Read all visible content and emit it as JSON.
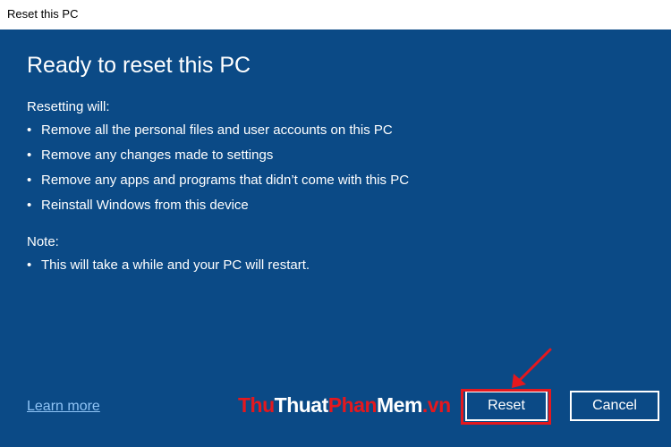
{
  "window": {
    "title": "Reset this PC"
  },
  "dialog": {
    "heading": "Ready to reset this PC",
    "resetting_label": "Resetting will:",
    "resetting_items": [
      "Remove all the personal files and user accounts on this PC",
      "Remove any changes made to settings",
      "Remove any apps and programs that didn’t come with this PC",
      "Reinstall Windows from this device"
    ],
    "note_label": "Note:",
    "note_items": [
      "This will take a while and your PC will restart."
    ],
    "learn_more": "Learn more",
    "reset_button": "Reset",
    "cancel_button": "Cancel"
  },
  "watermark": {
    "part1": "Thu",
    "part2": "Thuat",
    "part3": "Phan",
    "part4": "Mem",
    "part5": ".vn"
  },
  "colors": {
    "dialog_bg": "#0b4a86",
    "link": "#8fc3f5",
    "highlight": "#e4181e",
    "watermark_red": "#e4181e"
  }
}
